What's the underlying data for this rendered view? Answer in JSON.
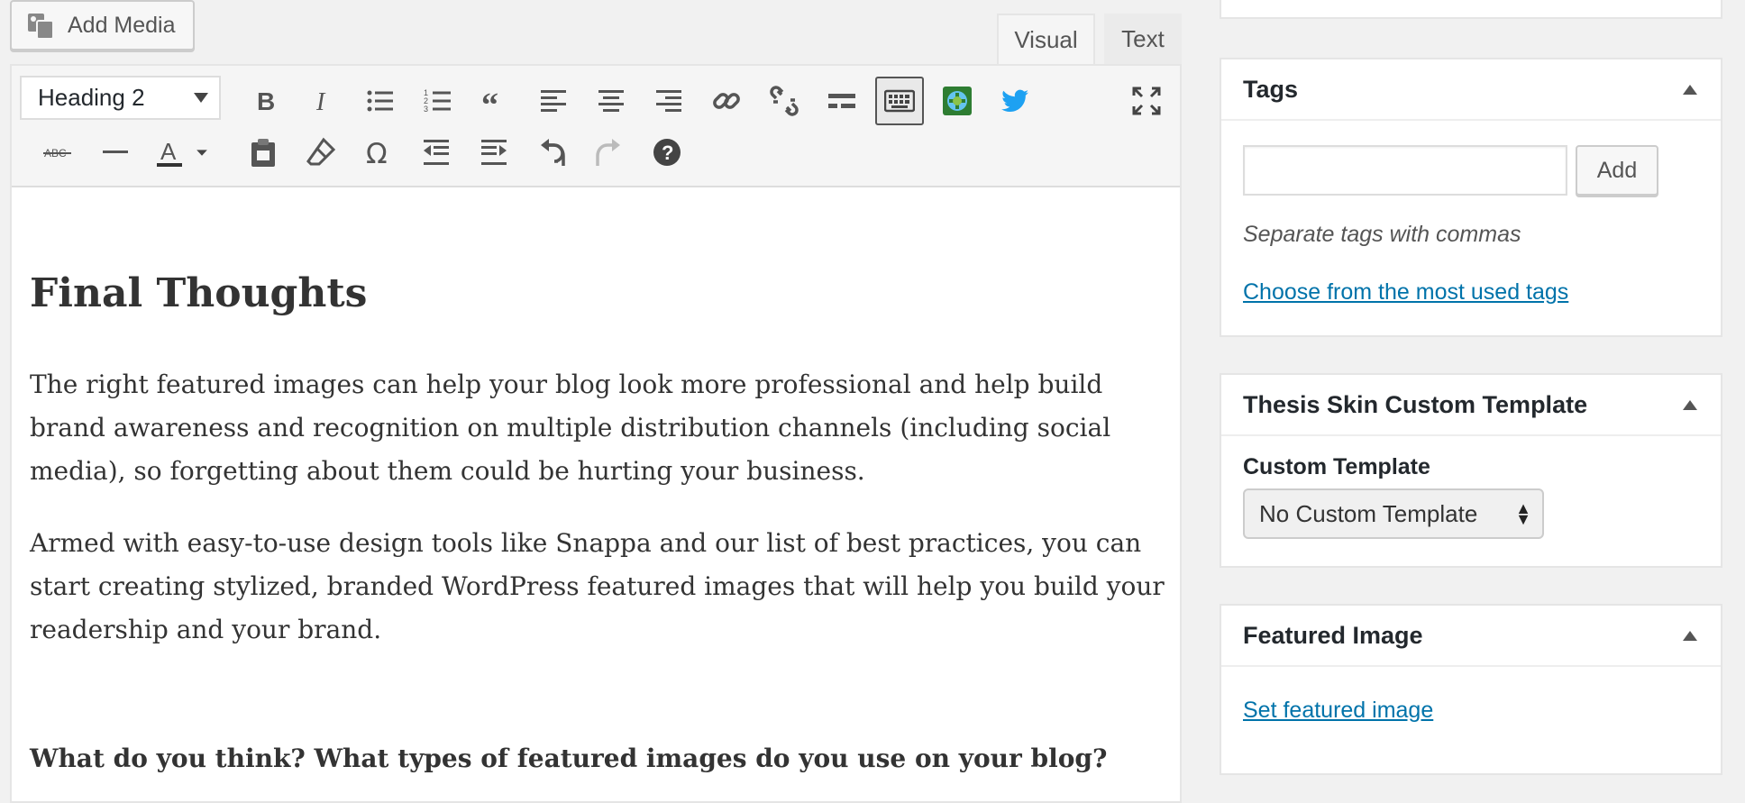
{
  "editor": {
    "add_media_label": "Add Media",
    "tabs": {
      "visual": "Visual",
      "text": "Text"
    },
    "format_select_value": "Heading 2",
    "heading": "Final Thoughts",
    "paragraphs": [
      "The right featured images can help your blog look more professional and help build brand awareness and recognition on multiple distribution channels (including social media), so forgetting about them could be hurting your business.",
      "Armed with easy-to-use design tools like Snappa and our list of best practices, you can start creating stylized, branded WordPress featured images that will help you build your readership and your brand."
    ],
    "question": "What do you think? What types of featured images do you use on your blog?"
  },
  "sidebar": {
    "tags": {
      "title": "Tags",
      "add_label": "Add",
      "hint": "Separate tags with commas",
      "link": "Choose from the most used tags"
    },
    "thesis": {
      "title": "Thesis Skin Custom Template",
      "field_label": "Custom Template",
      "select_value": "No Custom Template"
    },
    "featured": {
      "title": "Featured Image",
      "link": "Set featured image"
    }
  },
  "colors": {
    "link": "#0073aa",
    "twitter": "#1da1f2"
  }
}
